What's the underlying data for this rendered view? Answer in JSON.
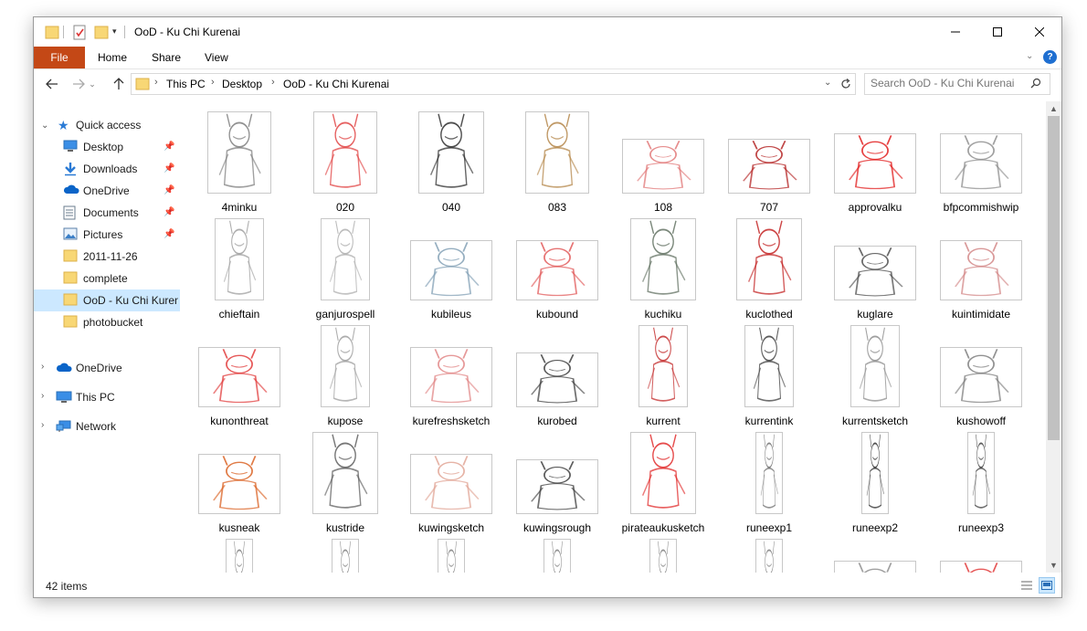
{
  "window": {
    "title": "OoD - Ku Chi Kurenai"
  },
  "ribbon": {
    "tabs": [
      "File",
      "Home",
      "Share",
      "View"
    ]
  },
  "address": {
    "segments": [
      "This PC",
      "Desktop",
      "OoD - Ku Chi Kurenai"
    ]
  },
  "search": {
    "placeholder": "Search OoD - Ku Chi Kurenai"
  },
  "nav": {
    "quick_access": "Quick access",
    "items": [
      {
        "label": "Desktop",
        "icon": "desktop-icon",
        "pinned": true
      },
      {
        "label": "Downloads",
        "icon": "download-icon",
        "pinned": true
      },
      {
        "label": "OneDrive",
        "icon": "cloud-icon",
        "pinned": true
      },
      {
        "label": "Documents",
        "icon": "document-icon",
        "pinned": true
      },
      {
        "label": "Pictures",
        "icon": "pictures-icon",
        "pinned": true
      },
      {
        "label": "2011-11-26",
        "icon": "folder-icon",
        "pinned": false
      },
      {
        "label": "complete",
        "icon": "folder-icon",
        "pinned": false
      },
      {
        "label": "OoD - Ku Chi Kuren",
        "icon": "folder-icon",
        "pinned": false,
        "selected": true
      },
      {
        "label": "photobucket",
        "icon": "folder-icon",
        "pinned": false
      }
    ],
    "roots": [
      {
        "label": "OneDrive",
        "icon": "cloud-icon"
      },
      {
        "label": "This PC",
        "icon": "computer-icon"
      },
      {
        "label": "Network",
        "icon": "network-icon"
      }
    ]
  },
  "files": [
    {
      "name": "4minku",
      "color": "#777777",
      "shape": "portrait"
    },
    {
      "name": "020",
      "color": "#e03a3a",
      "shape": "portrait"
    },
    {
      "name": "040",
      "color": "#222222",
      "shape": "portrait-sm"
    },
    {
      "name": "083",
      "color": "#b08040",
      "shape": "portrait"
    },
    {
      "name": "108",
      "color": "#e07070",
      "shape": "landscape-sm"
    },
    {
      "name": "707",
      "color": "#b01818",
      "shape": "landscape-sm"
    },
    {
      "name": "approvalku",
      "color": "#e01010",
      "shape": "landscape"
    },
    {
      "name": "bfpcommishwip",
      "color": "#888888",
      "shape": "landscape"
    },
    {
      "name": "chieftain",
      "color": "#999999",
      "shape": "portrait-thin"
    },
    {
      "name": "ganjurospell",
      "color": "#aaaaaa",
      "shape": "portrait-thin"
    },
    {
      "name": "kubileus",
      "color": "#7a9ab0",
      "shape": "landscape"
    },
    {
      "name": "kubound",
      "color": "#e05050",
      "shape": "landscape"
    },
    {
      "name": "kuchiku",
      "color": "#5a6a5a",
      "shape": "portrait-sm"
    },
    {
      "name": "kuclothed",
      "color": "#c01818",
      "shape": "portrait-sm"
    },
    {
      "name": "kuglare",
      "color": "#444444",
      "shape": "landscape-sm"
    },
    {
      "name": "kuintimidate",
      "color": "#d08080",
      "shape": "landscape"
    },
    {
      "name": "kunonthreat",
      "color": "#e03030",
      "shape": "landscape"
    },
    {
      "name": "kupose",
      "color": "#999999",
      "shape": "portrait-thin"
    },
    {
      "name": "kurefreshsketch",
      "color": "#e08080",
      "shape": "landscape"
    },
    {
      "name": "kurobed",
      "color": "#333333",
      "shape": "landscape-sm"
    },
    {
      "name": "kurrent",
      "color": "#c02020",
      "shape": "portrait-thin"
    },
    {
      "name": "kurrentink",
      "color": "#333333",
      "shape": "portrait-thin"
    },
    {
      "name": "kurrentsketch",
      "color": "#888888",
      "shape": "portrait-thin"
    },
    {
      "name": "kushowoff",
      "color": "#777777",
      "shape": "landscape"
    },
    {
      "name": "kusneak",
      "color": "#d85a18",
      "shape": "landscape"
    },
    {
      "name": "kustride",
      "color": "#555555",
      "shape": "portrait-sm"
    },
    {
      "name": "kuwingsketch",
      "color": "#e0a090",
      "shape": "landscape"
    },
    {
      "name": "kuwingsrough",
      "color": "#333333",
      "shape": "landscape-sm"
    },
    {
      "name": "pirateaukusketch",
      "color": "#e02020",
      "shape": "portrait-sm"
    },
    {
      "name": "runeexp1",
      "color": "#666666",
      "shape": "strip"
    },
    {
      "name": "runeexp2",
      "color": "#222222",
      "shape": "strip"
    },
    {
      "name": "runeexp3",
      "color": "#333333",
      "shape": "strip"
    },
    {
      "name": "",
      "color": "#777777",
      "shape": "strip"
    },
    {
      "name": "",
      "color": "#777777",
      "shape": "strip"
    },
    {
      "name": "",
      "color": "#777777",
      "shape": "strip"
    },
    {
      "name": "",
      "color": "#777777",
      "shape": "strip"
    },
    {
      "name": "",
      "color": "#777777",
      "shape": "strip"
    },
    {
      "name": "",
      "color": "#777777",
      "shape": "strip"
    },
    {
      "name": "",
      "color": "#888888",
      "shape": "landscape"
    },
    {
      "name": "",
      "color": "#e03030",
      "shape": "landscape"
    }
  ],
  "status": {
    "item_count": "42 items"
  }
}
